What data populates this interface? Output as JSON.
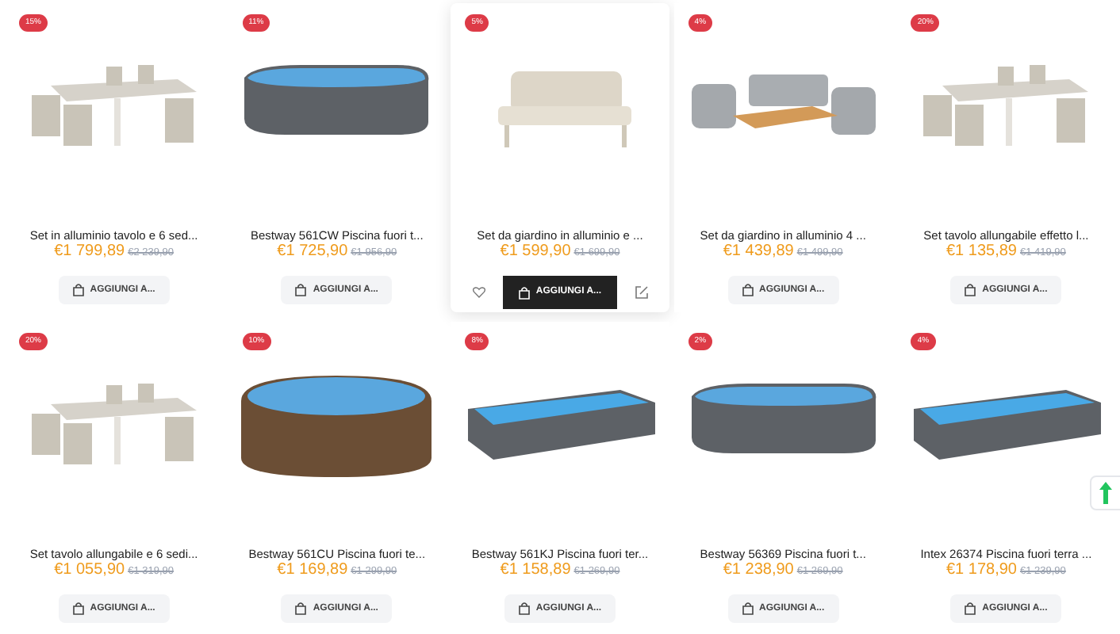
{
  "products": [
    {
      "badge": "15%",
      "kind": "furniture",
      "title": "Set in alluminio tavolo e 6 sed...",
      "price": "€1 799,89",
      "old_price": "€2 239,90",
      "button": "AGGIUNGI A...",
      "hovered": false
    },
    {
      "badge": "11%",
      "kind": "pool",
      "title": "Bestway 561CW Piscina fuori t...",
      "price": "€1 725,90",
      "old_price": "€1 956,90",
      "button": "AGGIUNGI A...",
      "hovered": false
    },
    {
      "badge": "5%",
      "kind": "sofa",
      "title": "Set da giardino in alluminio e ...",
      "price": "€1 599,90",
      "old_price": "€1 699,90",
      "button": "AGGIUNGI A...",
      "hovered": true
    },
    {
      "badge": "4%",
      "kind": "lounge",
      "title": "Set da giardino in alluminio 4 ...",
      "price": "€1 439,89",
      "old_price": "€1 499,90",
      "button": "AGGIUNGI A...",
      "hovered": false
    },
    {
      "badge": "20%",
      "kind": "furniture",
      "title": "Set tavolo allungabile effetto l...",
      "price": "€1 135,89",
      "old_price": "€1 419,90",
      "button": "AGGIUNGI A...",
      "hovered": false
    },
    {
      "badge": "20%",
      "kind": "furniture",
      "title": "Set tavolo allungabile e 6 sedi...",
      "price": "€1 055,90",
      "old_price": "€1 319,90",
      "button": "AGGIUNGI A...",
      "hovered": false
    },
    {
      "badge": "10%",
      "kind": "round-pool",
      "title": "Bestway 561CU Piscina fuori te...",
      "price": "€1 169,89",
      "old_price": "€1 299,90",
      "button": "AGGIUNGI A...",
      "hovered": false
    },
    {
      "badge": "8%",
      "kind": "frame-pool",
      "title": "Bestway 561KJ Piscina fuori ter...",
      "price": "€1 158,89",
      "old_price": "€1 269,90",
      "button": "AGGIUNGI A...",
      "hovered": false
    },
    {
      "badge": "2%",
      "kind": "pool",
      "title": "Bestway 56369 Piscina fuori t...",
      "price": "€1 238,90",
      "old_price": "€1 269,90",
      "button": "AGGIUNGI A...",
      "hovered": false
    },
    {
      "badge": "4%",
      "kind": "frame-pool",
      "title": "Intex 26374 Piscina fuori terra ...",
      "price": "€1 178,90",
      "old_price": "€1 239,90",
      "button": "AGGIUNGI A...",
      "hovered": false
    }
  ]
}
